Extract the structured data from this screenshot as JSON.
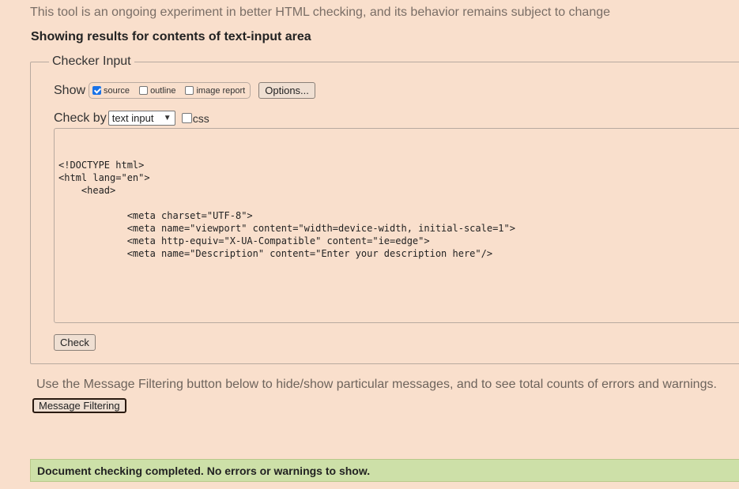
{
  "header": {
    "disclaimer": "This tool is an ongoing experiment in better HTML checking, and its behavior remains subject to change",
    "results_heading": "Showing results for contents of text-input area"
  },
  "checker_input": {
    "legend": "Checker Input",
    "show_label": "Show",
    "show_options": [
      {
        "label": "source",
        "checked": true
      },
      {
        "label": "outline",
        "checked": false
      },
      {
        "label": "image report",
        "checked": false
      }
    ],
    "options_button": "Options...",
    "check_by_label": "Check by",
    "check_by_selected": "text input",
    "css_label": "css",
    "css_checked": false,
    "source_code": "\n\n<!DOCTYPE html>\n<html lang=\"en\">\n    <head>\n\n            <meta charset=\"UTF-8\">\n            <meta name=\"viewport\" content=\"width=device-width, initial-scale=1\">\n            <meta http-equiv=\"X-UA-Compatible\" content=\"ie=edge\">\n            <meta name=\"Description\" content=\"Enter your description here\"/>",
    "check_button": "Check"
  },
  "filtering": {
    "note": "Use the Message Filtering button below to hide/show particular messages, and to see total counts of errors and warnings.",
    "button": "Message Filtering"
  },
  "status": {
    "message": "Document checking completed. No errors or warnings to show."
  },
  "colors": {
    "background": "#f9dfcc",
    "success": "#cde0a8",
    "checkbox_checked": "#1a73e8"
  }
}
